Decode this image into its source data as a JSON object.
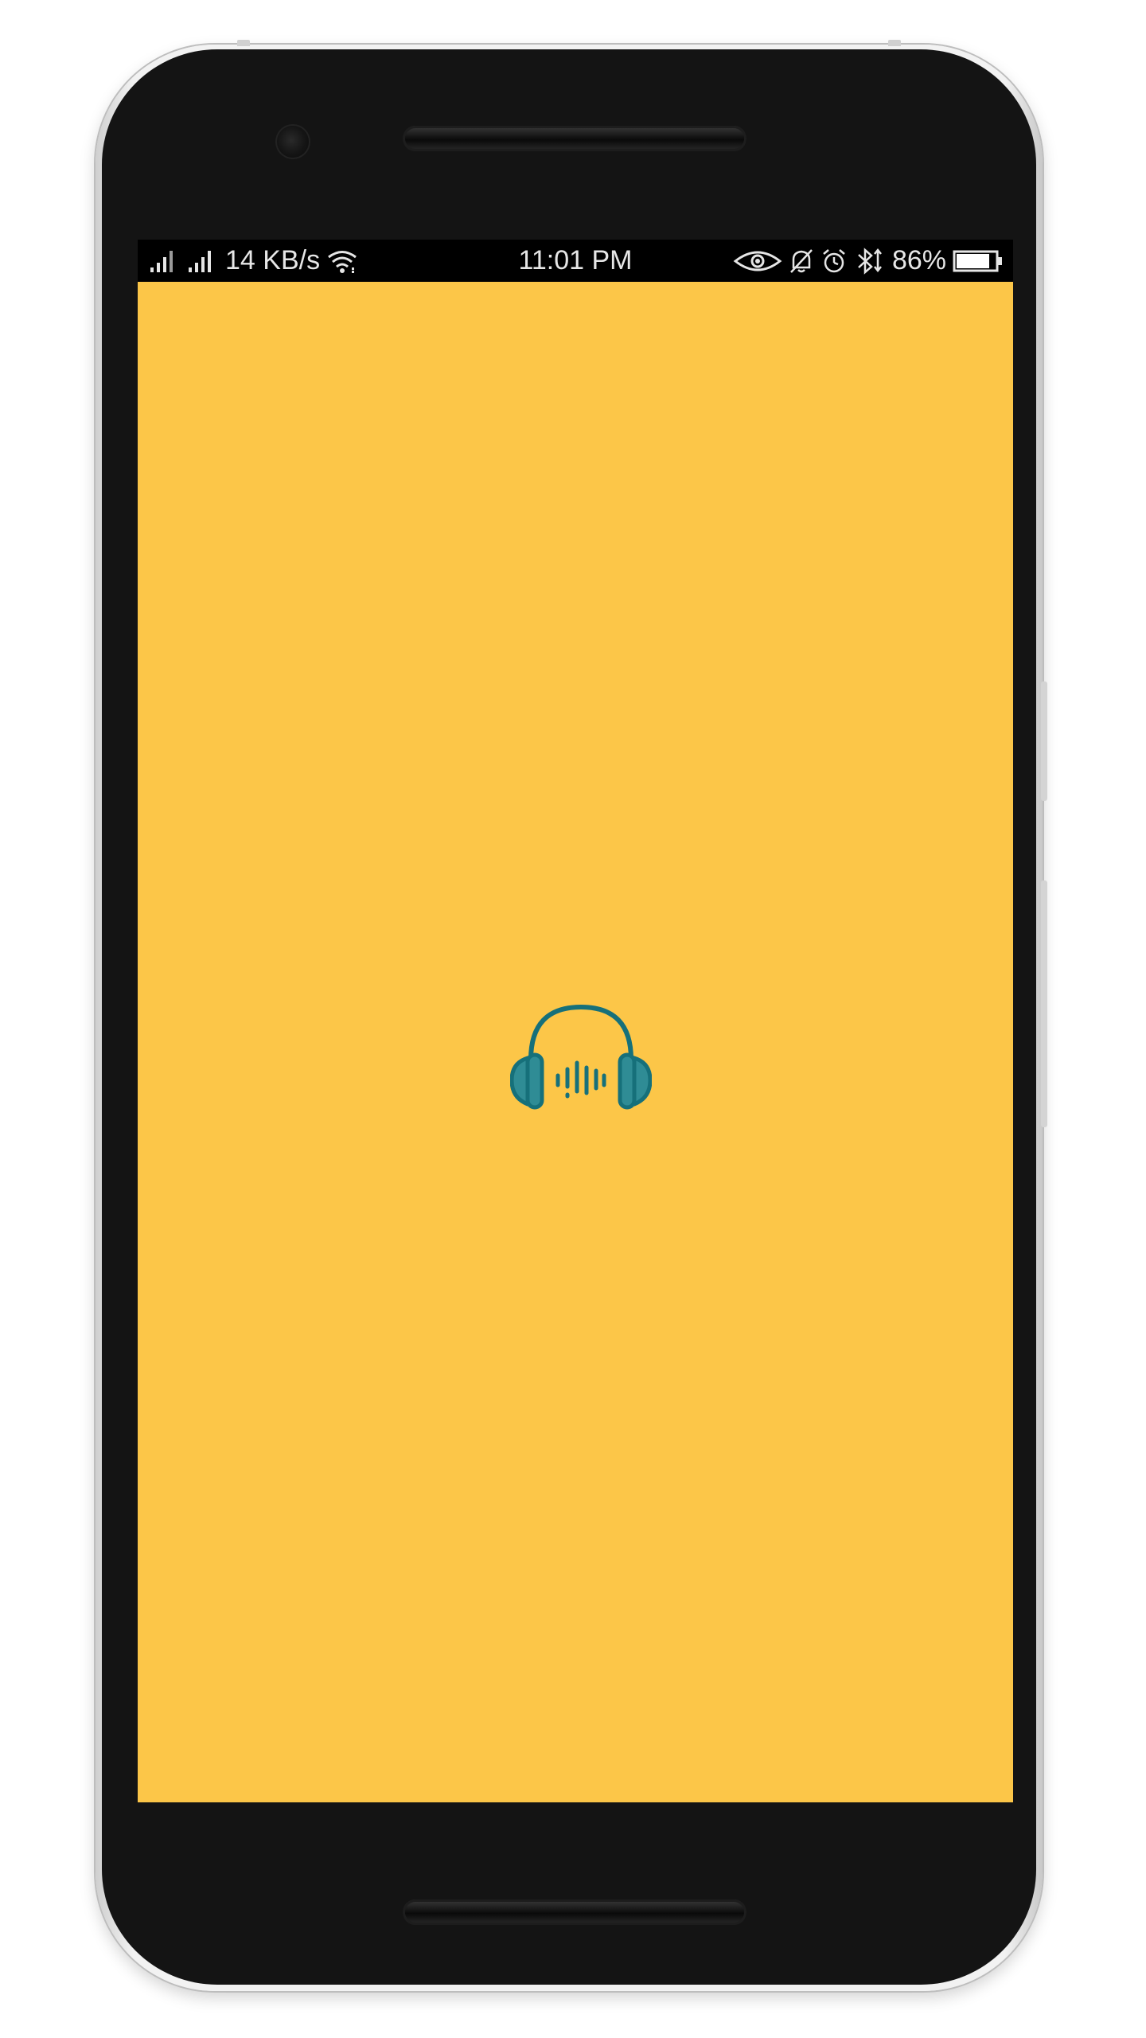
{
  "status_bar": {
    "network_speed": "14 KB/s",
    "time": "11:01 PM",
    "battery_percent": "86%",
    "battery_level": 0.86,
    "icons": [
      "signal-sim1-icon",
      "signal-sim2-icon",
      "wifi-icon",
      "eye-comfort-icon",
      "bell-muted-icon",
      "alarm-icon",
      "bluetooth-icon",
      "battery-icon"
    ]
  },
  "splash": {
    "background_color": "#fcc648",
    "logo_icon": "headphones-soundwave-icon",
    "logo_color": "#16707a",
    "logo_fill": "#2f8c95"
  },
  "device": {
    "frame_color": "#141414"
  }
}
